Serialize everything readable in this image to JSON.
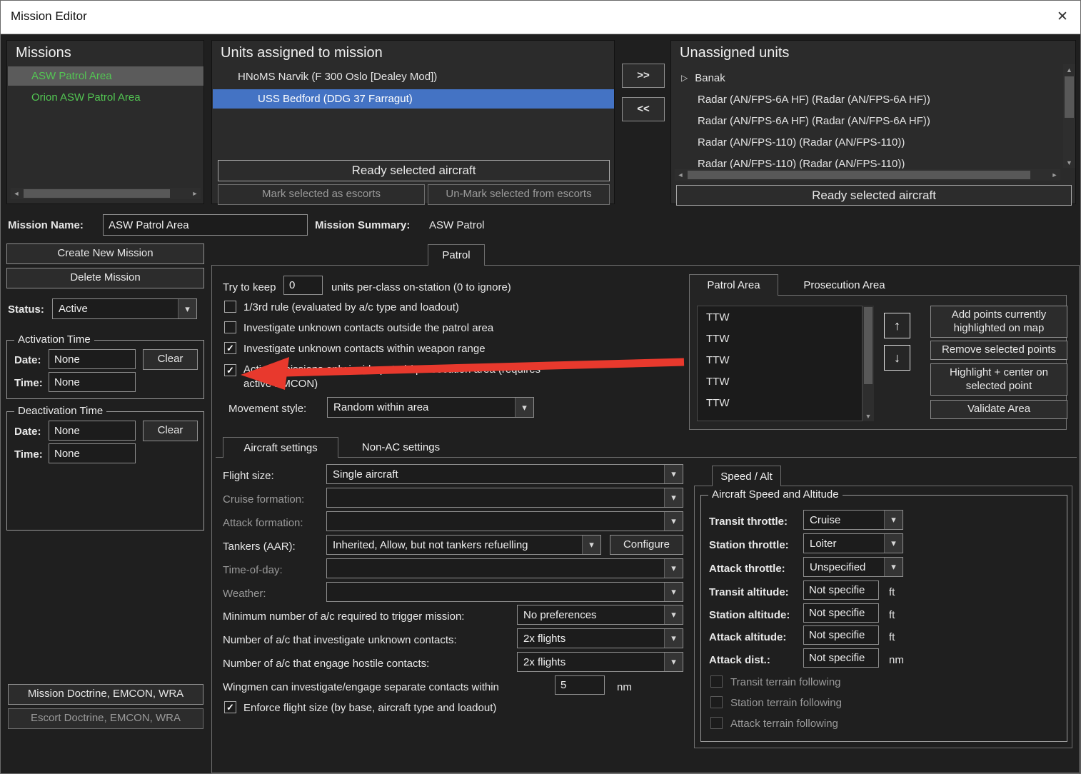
{
  "window": {
    "title": "Mission Editor"
  },
  "colors": {
    "selection_blue": "#4473C4",
    "mission_green": "#53C653",
    "arrow_red": "#E8392D"
  },
  "icons": {
    "close": "✕",
    "chevron_down": "▾",
    "check": "✓",
    "tree_expand": "▷",
    "scroll_up": "▲",
    "scroll_down": "▼",
    "scroll_left": "◄",
    "scroll_right": "►",
    "move_up": "↑",
    "move_down": "↓"
  },
  "missions": {
    "title": "Missions",
    "items": [
      {
        "label": "ASW Patrol Area",
        "selected": true
      },
      {
        "label": "Orion ASW Patrol Area",
        "selected": false
      }
    ]
  },
  "assigned": {
    "title": "Units assigned to mission",
    "items": [
      {
        "label": "HNoMS Narvik (F 300 Oslo [Dealey Mod])",
        "selected": false
      },
      {
        "label": "USS Bedford (DDG 37 Farragut)",
        "selected": true
      }
    ],
    "ready_button": "Ready selected aircraft",
    "mark_button": "Mark selected as escorts",
    "unmark_button": "Un-Mark selected from escorts"
  },
  "transfer": {
    "assign_label": ">>",
    "unassign_label": "<<"
  },
  "unassigned": {
    "title": "Unassigned units",
    "group": "Banak",
    "items": [
      "Radar (AN/FPS-6A HF) (Radar (AN/FPS-6A HF))",
      "Radar (AN/FPS-6A HF) (Radar (AN/FPS-6A HF))",
      "Radar (AN/FPS-110) (Radar (AN/FPS-110))",
      "Radar (AN/FPS-110) (Radar (AN/FPS-110))"
    ],
    "ready_button": "Ready selected aircraft"
  },
  "mission_header": {
    "name_label": "Mission Name:",
    "name_value": "ASW Patrol Area",
    "summary_label": "Mission Summary:",
    "summary_value": "ASW Patrol"
  },
  "sidebar": {
    "create_button": "Create New Mission",
    "delete_button": "Delete Mission",
    "status_label": "Status:",
    "status_value": "Active",
    "activation": {
      "title": "Activation Time",
      "date_label": "Date:",
      "date_value": "None",
      "time_label": "Time:",
      "time_value": "None",
      "clear_button": "Clear"
    },
    "deactivation": {
      "title": "Deactivation Time",
      "date_label": "Date:",
      "date_value": "None",
      "time_label": "Time:",
      "time_value": "None",
      "clear_button": "Clear"
    },
    "mission_doctrine_button": "Mission Doctrine, EMCON, WRA",
    "escort_doctrine_button": "Escort Doctrine, EMCON, WRA"
  },
  "patrol": {
    "tab": "Patrol",
    "keep_label": "Try to keep",
    "keep_value": "0",
    "keep_suffix": "units per-class on-station (0 to ignore)",
    "cb_third_rule": {
      "label": "1/3rd rule (evaluated by a/c type and loadout)",
      "checked": false
    },
    "cb_outside": {
      "label": "Investigate unknown contacts outside the patrol area",
      "checked": false
    },
    "cb_within": {
      "label": "Investigate unknown contacts within weapon range",
      "checked": true
    },
    "cb_emissions": {
      "label": "Active emissions only inside patrol / prosecution area (requires active EMCON)",
      "checked": true
    },
    "movement_label": "Movement style:",
    "movement_value": "Random within area"
  },
  "area": {
    "tab_patrol": "Patrol Area",
    "tab_prosecution": "Prosecution Area",
    "points": [
      "TTW",
      "TTW",
      "TTW",
      "TTW",
      "TTW"
    ],
    "add_button": "Add points currently highlighted on map",
    "remove_button": "Remove selected points",
    "highlight_button": "Highlight + center on selected point",
    "validate_button": "Validate Area"
  },
  "settings": {
    "tab_aircraft": "Aircraft settings",
    "tab_nonac": "Non-AC settings",
    "flight_size_label": "Flight size:",
    "flight_size_value": "Single aircraft",
    "cruise_label": "Cruise formation:",
    "cruise_value": "",
    "attack_label": "Attack formation:",
    "attack_value": "",
    "tankers_label": "Tankers (AAR):",
    "tankers_value": "Inherited, Allow, but not tankers refuelling",
    "configure_button": "Configure",
    "tod_label": "Time-of-day:",
    "tod_value": "",
    "weather_label": "Weather:",
    "weather_value": "",
    "min_label": "Minimum number of a/c required to trigger mission:",
    "min_value": "No preferences",
    "investigate_label": "Number of a/c that investigate unknown contacts:",
    "investigate_value": "2x flights",
    "engage_label": "Number of a/c that engage hostile contacts:",
    "engage_value": "2x flights",
    "wingmen_label": "Wingmen can investigate/engage separate contacts within",
    "wingmen_value": "5",
    "wingmen_unit": "nm",
    "cb_enforce": {
      "label": "Enforce flight size (by base, aircraft type and loadout)",
      "checked": true
    }
  },
  "speed_alt": {
    "tab": "Speed / Alt",
    "group_title": "Aircraft Speed and Altitude",
    "transit_throttle_label": "Transit throttle:",
    "transit_throttle_value": "Cruise",
    "station_throttle_label": "Station throttle:",
    "station_throttle_value": "Loiter",
    "attack_throttle_label": "Attack throttle:",
    "attack_throttle_value": "Unspecified",
    "transit_alt_label": "Transit altitude:",
    "transit_alt_value": "Not specifie",
    "station_alt_label": "Station altitude:",
    "station_alt_value": "Not specifie",
    "attack_alt_label": "Attack altitude:",
    "attack_alt_value": "Not specifie",
    "attack_dist_label": "Attack dist.:",
    "attack_dist_value": "Not specifie",
    "ft_unit": "ft",
    "nm_unit": "nm",
    "cb_transit": {
      "label": "Transit terrain following",
      "checked": false
    },
    "cb_station": {
      "label": "Station terrain following",
      "checked": false
    },
    "cb_attack": {
      "label": "Attack terrain following",
      "checked": false
    }
  }
}
